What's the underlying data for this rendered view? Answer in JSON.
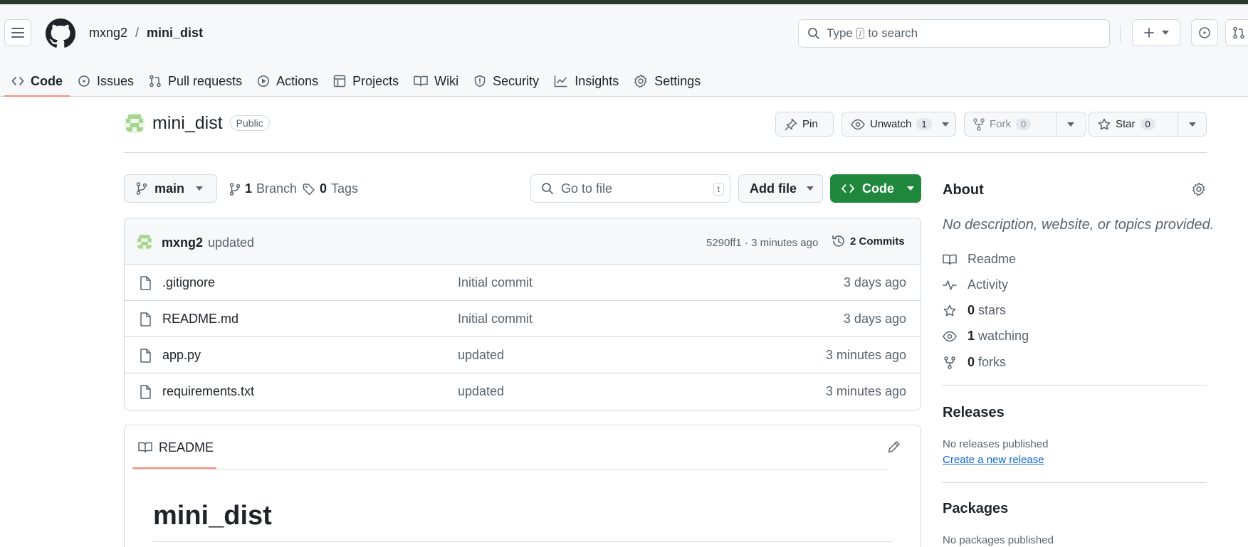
{
  "header": {
    "owner": "mxng2",
    "separator": "/",
    "repo": "mini_dist",
    "search_prefix": "Type",
    "search_key": "/",
    "search_suffix": "to search"
  },
  "tabs": [
    {
      "label": "Code",
      "icon": "code-icon",
      "active": true
    },
    {
      "label": "Issues",
      "icon": "issue-icon"
    },
    {
      "label": "Pull requests",
      "icon": "pull-request-icon"
    },
    {
      "label": "Actions",
      "icon": "play-icon"
    },
    {
      "label": "Projects",
      "icon": "table-icon"
    },
    {
      "label": "Wiki",
      "icon": "book-icon"
    },
    {
      "label": "Security",
      "icon": "shield-icon"
    },
    {
      "label": "Insights",
      "icon": "graph-icon"
    },
    {
      "label": "Settings",
      "icon": "gear-icon"
    }
  ],
  "repo": {
    "name": "mini_dist",
    "visibility": "Public",
    "pin_label": "Pin",
    "unwatch_label": "Unwatch",
    "watch_count": "1",
    "fork_label": "Fork",
    "fork_count": "0",
    "star_label": "Star",
    "star_count": "0"
  },
  "toolbar": {
    "branch": "main",
    "branch_count": "1",
    "branch_label": "Branch",
    "tag_count": "0",
    "tag_label": "Tags",
    "goto_placeholder": "Go to file",
    "goto_key": "t",
    "add_file_label": "Add file",
    "code_label": "Code"
  },
  "commit": {
    "author": "mxng2",
    "message": "updated",
    "sha_time": "5290ff1 · 3 minutes ago",
    "commits_label": "2 Commits"
  },
  "files": [
    {
      "name": ".gitignore",
      "message": "Initial commit",
      "date": "3 days ago"
    },
    {
      "name": "README.md",
      "message": "Initial commit",
      "date": "3 days ago"
    },
    {
      "name": "app.py",
      "message": "updated",
      "date": "3 minutes ago"
    },
    {
      "name": "requirements.txt",
      "message": "updated",
      "date": "3 minutes ago"
    }
  ],
  "readme": {
    "tab_label": "README",
    "heading": "mini_dist"
  },
  "about": {
    "title": "About",
    "description": "No description, website, or topics provided.",
    "readme_label": "Readme",
    "activity_label": "Activity",
    "stars_count": "0",
    "stars_label": "stars",
    "watching_count": "1",
    "watching_label": "watching",
    "forks_count": "0",
    "forks_label": "forks"
  },
  "releases": {
    "title": "Releases",
    "note": "No releases published",
    "link": "Create a new release"
  },
  "packages": {
    "title": "Packages",
    "note": "No packages published"
  },
  "colors": {
    "accent_green": "#1f883d",
    "tab_underline": "#fd8c73",
    "link_blue": "#0969da"
  }
}
